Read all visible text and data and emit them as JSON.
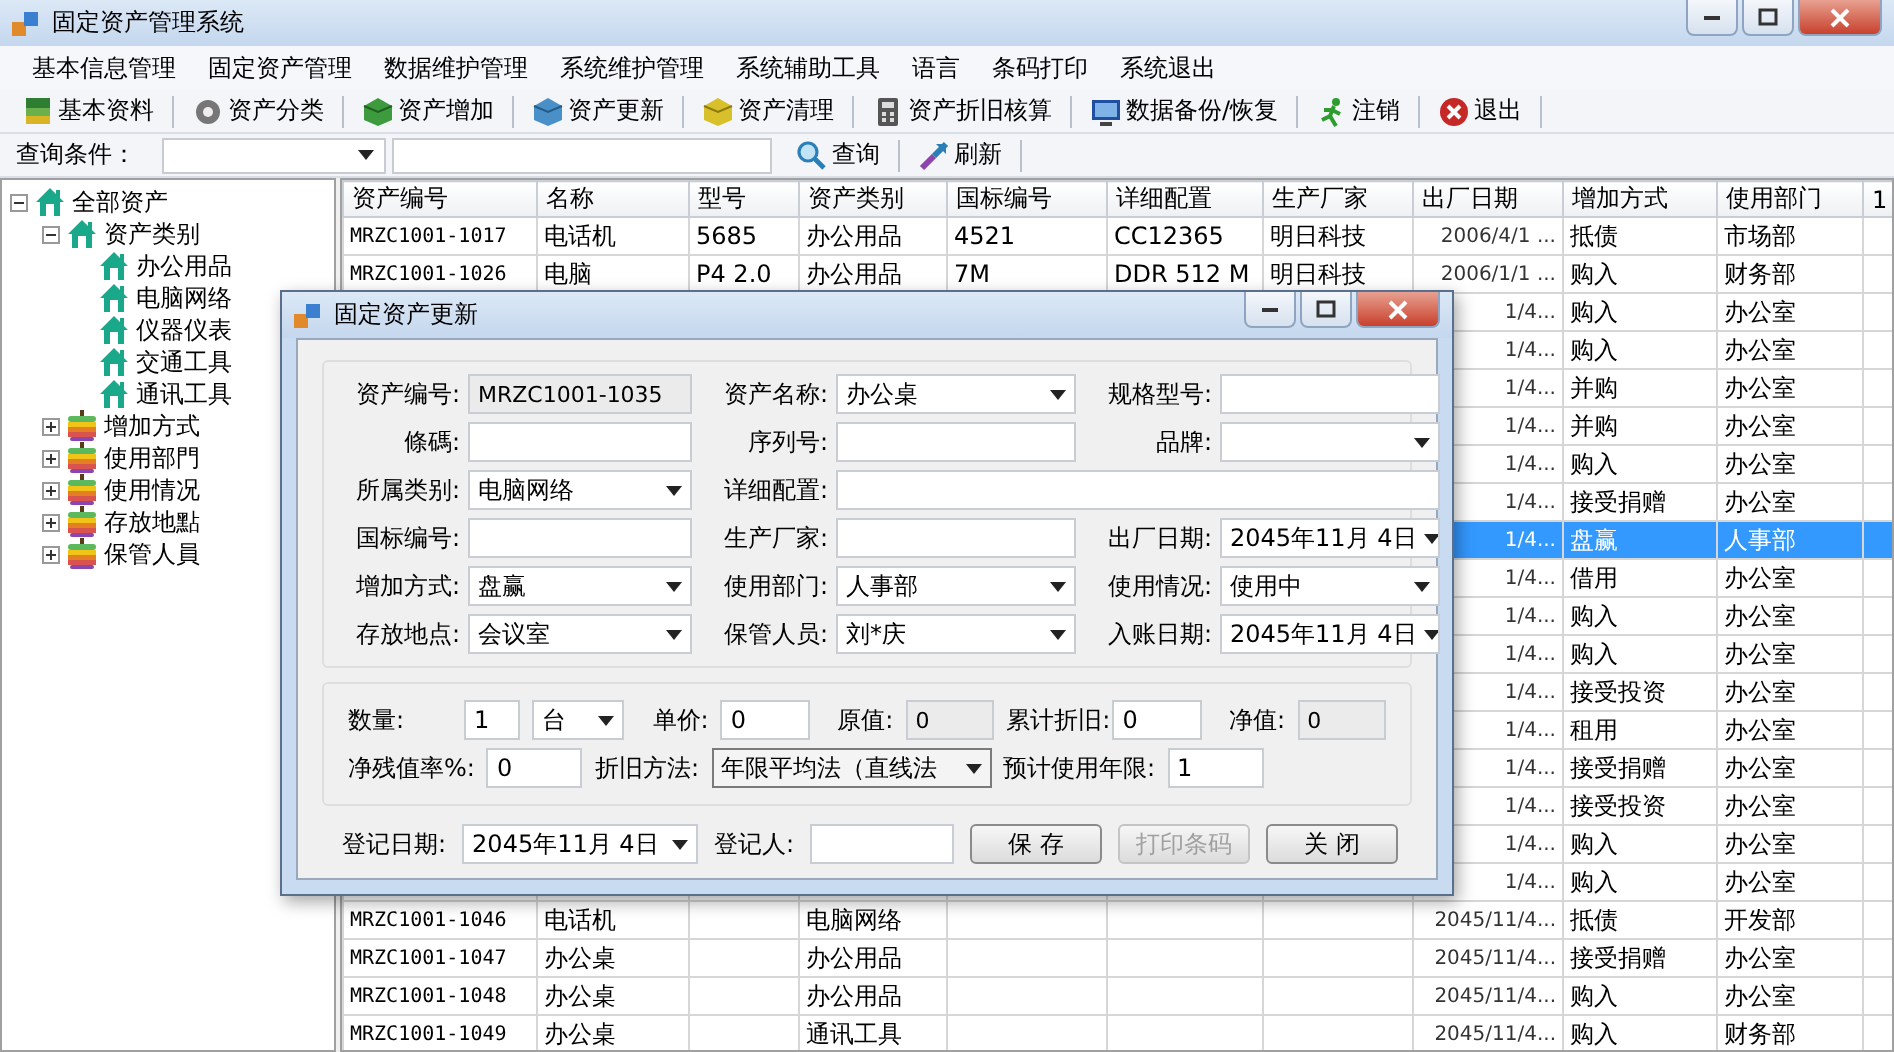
{
  "window": {
    "title": "固定资产管理系统"
  },
  "menu": [
    "基本信息管理",
    "固定资产管理",
    "数据维护管理",
    "系统维护管理",
    "系统辅助工具",
    "语言",
    "条码打印",
    "系统退出"
  ],
  "toolbar": [
    "基本资料",
    "资产分类",
    "资产增加",
    "资产更新",
    "资产清理",
    "资产折旧核算",
    "数据备份/恢复",
    "注销",
    "退出"
  ],
  "query": {
    "label": "查询条件：",
    "search_button": "查询",
    "refresh_button": "刷新"
  },
  "tree": [
    {
      "label": "全部资产",
      "kind": "house",
      "expanded": true,
      "children": [
        {
          "label": "资产类别",
          "kind": "house",
          "expanded": true,
          "children": [
            {
              "label": "办公用品",
              "kind": "house"
            },
            {
              "label": "电脑网络",
              "kind": "house"
            },
            {
              "label": "仪器仪表",
              "kind": "house"
            },
            {
              "label": "交通工具",
              "kind": "house"
            },
            {
              "label": "通讯工具",
              "kind": "house"
            }
          ]
        },
        {
          "label": "增加方式",
          "kind": "apple",
          "expanded": false
        },
        {
          "label": "使用部門",
          "kind": "apple",
          "expanded": false
        },
        {
          "label": "使用情况",
          "kind": "apple",
          "expanded": false
        },
        {
          "label": "存放地點",
          "kind": "apple",
          "expanded": false
        },
        {
          "label": "保管人員",
          "kind": "apple",
          "expanded": false
        }
      ]
    }
  ],
  "table": {
    "columns": [
      "资产编号",
      "名称",
      "型号",
      "资产类别",
      "国标编号",
      "详细配置",
      "生产厂家",
      "出厂日期",
      "增加方式",
      "使用部门",
      "1"
    ],
    "rows": [
      {
        "selected": false,
        "cells": [
          "MRZC1001-1017",
          "电话机",
          "5685",
          "办公用品",
          "4521",
          "CC12365",
          "明日科技",
          "2006/4/1 ...",
          "抵债",
          "市场部",
          null
        ]
      },
      {
        "selected": false,
        "cells": [
          "MRZC1001-1026",
          "电脑",
          "P4 2.0",
          "办公用品",
          "7M",
          "DDR 512 M",
          "明日科技",
          "2006/1/1 ...",
          "购入",
          "财务部",
          null
        ]
      },
      {
        "selected": false,
        "cells": [
          null,
          null,
          null,
          null,
          null,
          null,
          null,
          "1/4...",
          "购入",
          "办公室",
          null
        ]
      },
      {
        "selected": false,
        "cells": [
          null,
          null,
          null,
          null,
          null,
          null,
          null,
          "1/4...",
          "购入",
          "办公室",
          null
        ]
      },
      {
        "selected": false,
        "cells": [
          null,
          null,
          null,
          null,
          null,
          null,
          null,
          "1/4...",
          "并购",
          "办公室",
          null
        ]
      },
      {
        "selected": false,
        "cells": [
          null,
          null,
          null,
          null,
          null,
          null,
          null,
          "1/4...",
          "并购",
          "办公室",
          null
        ]
      },
      {
        "selected": false,
        "cells": [
          null,
          null,
          null,
          null,
          null,
          null,
          null,
          "1/4...",
          "购入",
          "办公室",
          null
        ]
      },
      {
        "selected": false,
        "cells": [
          null,
          null,
          null,
          null,
          null,
          null,
          null,
          "1/4...",
          "接受捐赠",
          "办公室",
          null
        ]
      },
      {
        "selected": true,
        "cells": [
          null,
          null,
          null,
          null,
          null,
          null,
          null,
          "1/4...",
          "盘赢",
          "人事部",
          null
        ]
      },
      {
        "selected": false,
        "cells": [
          null,
          null,
          null,
          null,
          null,
          null,
          null,
          "1/4...",
          "借用",
          "办公室",
          null
        ]
      },
      {
        "selected": false,
        "cells": [
          null,
          null,
          null,
          null,
          null,
          null,
          null,
          "1/4...",
          "购入",
          "办公室",
          null
        ]
      },
      {
        "selected": false,
        "cells": [
          null,
          null,
          null,
          null,
          null,
          null,
          null,
          "1/4...",
          "购入",
          "办公室",
          null
        ]
      },
      {
        "selected": false,
        "cells": [
          null,
          null,
          null,
          null,
          null,
          null,
          null,
          "1/4...",
          "接受投资",
          "办公室",
          null
        ]
      },
      {
        "selected": false,
        "cells": [
          null,
          null,
          null,
          null,
          null,
          null,
          null,
          "1/4...",
          "租用",
          "办公室",
          null
        ]
      },
      {
        "selected": false,
        "cells": [
          null,
          null,
          null,
          null,
          null,
          null,
          null,
          "1/4...",
          "接受捐赠",
          "办公室",
          null
        ]
      },
      {
        "selected": false,
        "cells": [
          null,
          null,
          null,
          null,
          null,
          null,
          null,
          "1/4...",
          "接受投资",
          "办公室",
          null
        ]
      },
      {
        "selected": false,
        "cells": [
          null,
          null,
          null,
          null,
          null,
          null,
          null,
          "1/4...",
          "购入",
          "办公室",
          null
        ]
      },
      {
        "selected": false,
        "cells": [
          null,
          null,
          null,
          null,
          null,
          null,
          null,
          "1/4...",
          "购入",
          "办公室",
          null
        ]
      },
      {
        "selected": false,
        "cells": [
          "MRZC1001-1046",
          "电话机",
          null,
          "电脑网络",
          null,
          null,
          null,
          "2045/11/4...",
          "抵债",
          "开发部",
          null
        ]
      },
      {
        "selected": false,
        "cells": [
          "MRZC1001-1047",
          "办公桌",
          null,
          "办公用品",
          null,
          null,
          null,
          "2045/11/4...",
          "接受捐赠",
          "办公室",
          null
        ]
      },
      {
        "selected": false,
        "cells": [
          "MRZC1001-1048",
          "办公桌",
          null,
          "办公用品",
          null,
          null,
          null,
          "2045/11/4...",
          "购入",
          "办公室",
          null
        ]
      },
      {
        "selected": false,
        "cells": [
          "MRZC1001-1049",
          "办公桌",
          null,
          "通讯工具",
          null,
          null,
          null,
          "2045/11/4...",
          "购入",
          "财务部",
          null
        ]
      }
    ]
  },
  "dialog": {
    "title": "固定资产更新",
    "fields": [
      [
        {
          "label": "资产编号:",
          "value": "MRZC1001-1035",
          "kind": "readonly"
        },
        {
          "label": "资产名称:",
          "value": "办公桌",
          "kind": "combo"
        },
        {
          "label": "规格型号:",
          "kind": "text"
        }
      ],
      [
        {
          "label": "條碼:",
          "kind": "text"
        },
        {
          "label": "序列号:",
          "kind": "text"
        },
        {
          "label": "品牌:",
          "kind": "combo"
        }
      ],
      [
        {
          "label": "所属类别:",
          "value": "电脑网络",
          "kind": "combo"
        },
        {
          "label": "详细配置:",
          "kind": "text"
        }
      ],
      [
        {
          "label": "国标编号:",
          "kind": "text"
        },
        {
          "label": "生产厂家:",
          "kind": "text"
        },
        {
          "label": "出厂日期:",
          "value": "2045年11月 4日",
          "kind": "combo"
        }
      ],
      [
        {
          "label": "增加方式:",
          "value": "盘赢",
          "kind": "combo"
        },
        {
          "label": "使用部门:",
          "value": "人事部",
          "kind": "combo"
        },
        {
          "label": "使用情况:",
          "value": "使用中",
          "kind": "combo"
        }
      ],
      [
        {
          "label": "存放地点:",
          "value": "会议室",
          "kind": "combo"
        },
        {
          "label": "保管人员:",
          "value": "刘*庆",
          "kind": "combo"
        },
        {
          "label": "入账日期:",
          "value": "2045年11月 4日",
          "kind": "combo"
        }
      ]
    ],
    "amounts": [
      [
        {
          "label": "数量:",
          "value": "1",
          "kind": "text"
        },
        {
          "value": "台",
          "kind": "combo"
        },
        {
          "label": "单价:",
          "value": "0",
          "kind": "text"
        },
        {
          "label": "原值:",
          "value": "0",
          "kind": "readonly"
        },
        {
          "label": "累计折旧:",
          "value": "0",
          "kind": "text"
        },
        {
          "label": "净值:",
          "value": "0",
          "kind": "readonly"
        }
      ],
      [
        {
          "label": "净残值率%:",
          "value": "0",
          "kind": "text"
        },
        {
          "label": "折旧方法:",
          "value": "年限平均法（直线法",
          "kind": "combo"
        },
        {
          "label": "预计使用年限:",
          "value": "1",
          "kind": "text"
        }
      ]
    ],
    "register": [
      {
        "label": "登记日期:",
        "value": "2045年11月 4日",
        "kind": "combo"
      },
      {
        "label": "登记人:",
        "kind": "text"
      }
    ],
    "buttons": [
      {
        "label": "保 存",
        "disabled": false
      },
      {
        "label": "打印条码",
        "disabled": true
      },
      {
        "label": "关 闭",
        "disabled": false
      }
    ]
  }
}
